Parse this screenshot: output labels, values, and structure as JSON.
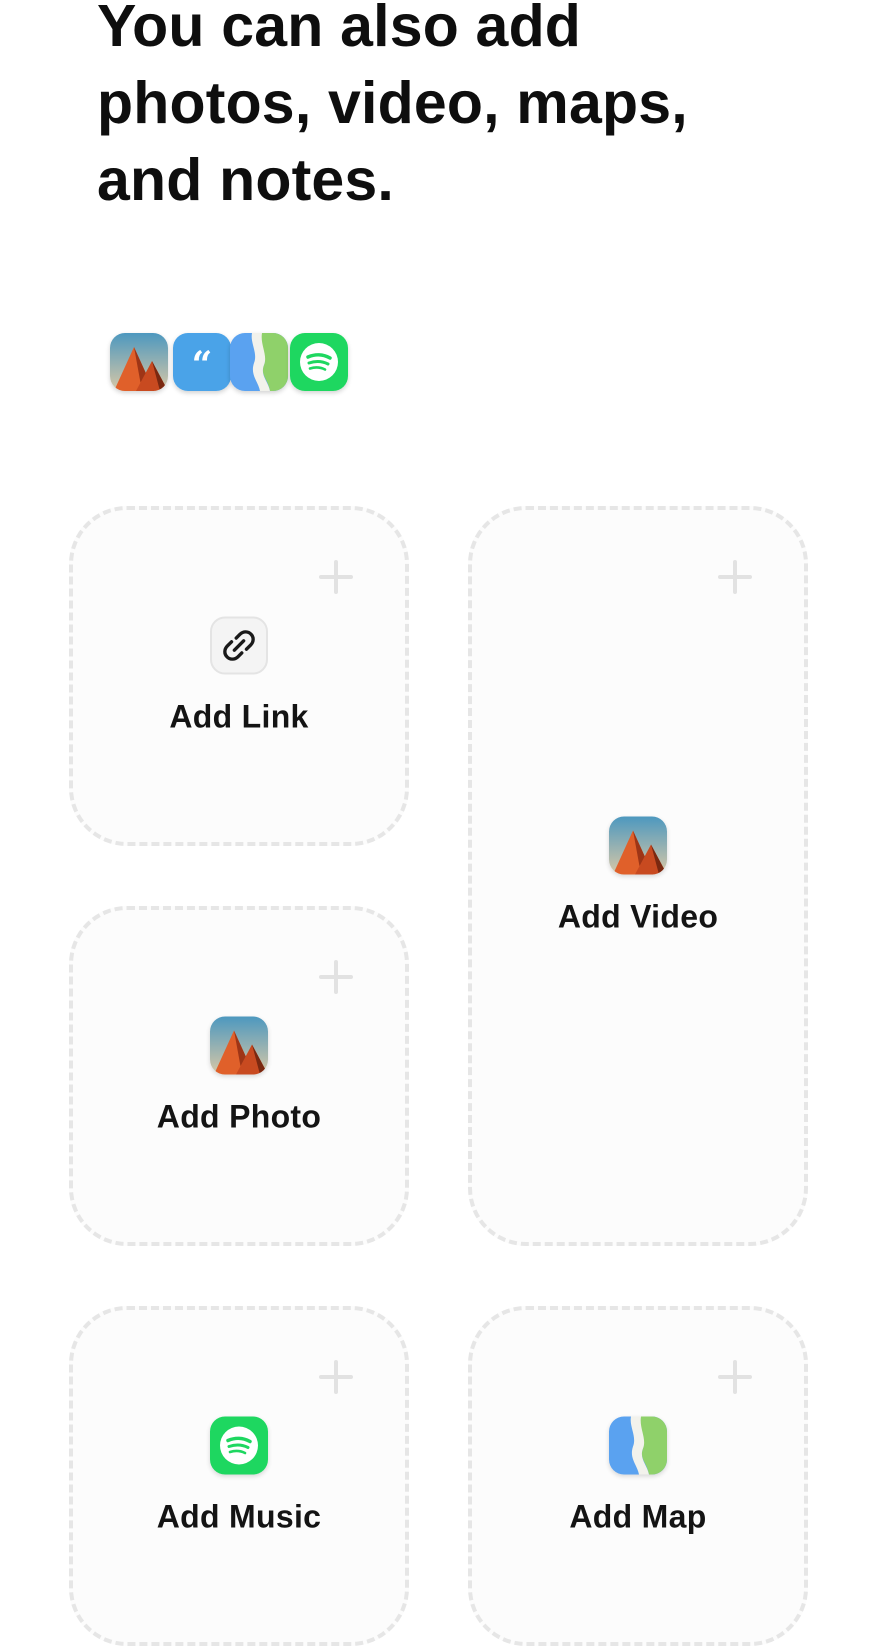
{
  "headline": {
    "lines": [
      "You can also add",
      "photos, video, maps,",
      "and notes."
    ]
  },
  "icon_strip": {
    "icons": [
      "photo-icon",
      "quote-icon",
      "map-icon",
      "spotify-icon"
    ]
  },
  "cards": {
    "link": {
      "label": "Add Link",
      "icon": "link-icon"
    },
    "video": {
      "label": "Add Video",
      "icon": "photo-icon"
    },
    "photo": {
      "label": "Add Photo",
      "icon": "photo-icon"
    },
    "music": {
      "label": "Add Music",
      "icon": "spotify-icon"
    },
    "map": {
      "label": "Add Map",
      "icon": "map-icon"
    }
  },
  "colors": {
    "card_border": "#e6e6e6",
    "card_background": "#fcfcfc",
    "spotify_green": "#1ed760",
    "quote_blue": "#4aa3e8",
    "map_blue": "#5aa2f0",
    "map_green": "#8fd16a"
  }
}
